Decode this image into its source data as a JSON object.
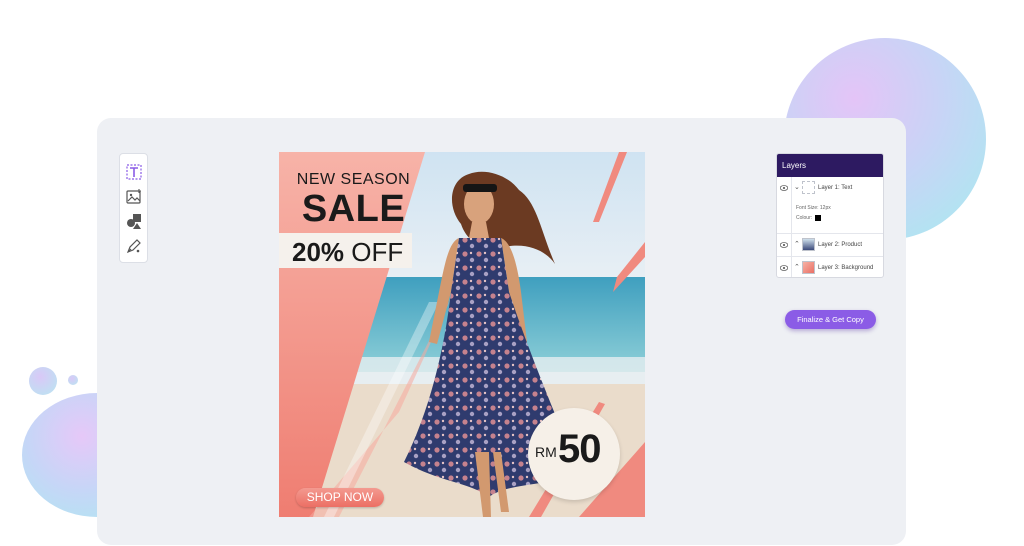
{
  "toolbar": {
    "tools": [
      {
        "icon": "text-tool-icon"
      },
      {
        "icon": "image-tool-icon"
      },
      {
        "icon": "shapes-tool-icon"
      },
      {
        "icon": "pen-tool-icon"
      }
    ]
  },
  "ad": {
    "subtitle": "NEW SEASON",
    "headline": "SALE",
    "discount_value": "20%",
    "discount_word": "OFF",
    "price_currency": "RM",
    "price_value": "50",
    "cta_label": "SHOP NOW",
    "colors": {
      "coral": "#f38d82",
      "sand": "#f1e6d9",
      "sea": "#5cb5c7"
    }
  },
  "layers_panel": {
    "title": "Layers",
    "layers": [
      {
        "label": "Layer 1: Text",
        "expanded": true,
        "props": {
          "font_size": "Font Size: 12px",
          "colour": "Colour:"
        }
      },
      {
        "label": "Layer 2: Product",
        "expanded": false
      },
      {
        "label": "Layer 3: Background",
        "expanded": false
      }
    ],
    "accent": "#2d1a61"
  },
  "finalize_button": {
    "label": "Finalize & Get Copy",
    "color": "#8b5ce6"
  }
}
